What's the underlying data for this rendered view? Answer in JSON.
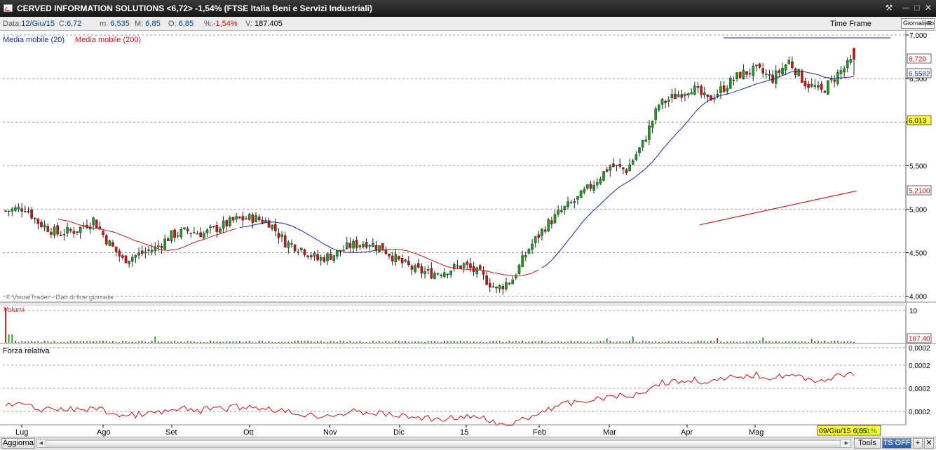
{
  "window": {
    "title": "CERVED INFORMATION SOLUTIONS <6,72> -1,54%  (FTSE Italia Beni e Servizi Industriali)",
    "buttons": [
      "wrench-icon",
      "minimize-icon",
      "maximize-icon",
      "close-icon"
    ]
  },
  "info": {
    "data_label": "Data:",
    "data_value": "12/Giu/15",
    "close_label": "C:",
    "close_value": "6,72",
    "min_label": "m:",
    "min_value": "6,535",
    "max_label": "M:",
    "max_value": "6,85",
    "open_label": "O:",
    "open_value": "6,85",
    "pct_label": "%:",
    "pct_value": "-1,54%",
    "vol_label": "V:",
    "vol_value": "187.405",
    "timeframe_label": "Time Frame",
    "timeframe_value": "Giornaliero"
  },
  "legend": {
    "ma20": "Media mobile (20)",
    "ma200": "Media mobile (200)"
  },
  "watermark": "© VisualTrader - Dati di fine giornata",
  "panels": {
    "volume_title": "Volumi",
    "volume_axis": "10",
    "rs_title": "Forza relativa"
  },
  "price_axis": {
    "ticks": [
      "7,000",
      "6,500",
      "6,000",
      "5,500",
      "5,000",
      "4,500",
      "4,000"
    ]
  },
  "badges": {
    "last": "6,720",
    "ma20": "6,5582",
    "level": "6,013",
    "ma200": "5,2100",
    "volume": "187.40"
  },
  "rs_axis": [
    "0,0002",
    "0,0002",
    "0,0002",
    "0,0002"
  ],
  "x_axis": [
    "Lug",
    "Ago",
    "Set",
    "Ott",
    "Nov",
    "Dic",
    "15",
    "Feb",
    "Mar",
    "Apr",
    "Mag"
  ],
  "cursor_info": {
    "date": "09/Giu/15",
    "value": "6,65",
    "pct": "0,61%"
  },
  "bottom": {
    "aggiorna": "Aggiorna",
    "tools": "Tools",
    "ts_off": "TS OFF",
    "plus": "+"
  },
  "colors": {
    "up": "#1f9a1f",
    "down": "#c81414",
    "ma20": "#1a2a9e",
    "ma200": "#cc1a1a",
    "rs": "#c81414",
    "level_badge": "#ffff33",
    "grid": "#9a9a9a"
  },
  "chart_data": {
    "type": "candlestick",
    "series_note": "daily OHLC approximations, Jul 2014 - Jun 2015",
    "ylim": [
      4.0,
      7.0
    ],
    "anchors": [
      [
        0,
        4.98
      ],
      [
        6,
        5.02
      ],
      [
        10,
        4.85
      ],
      [
        16,
        4.72
      ],
      [
        22,
        4.76
      ],
      [
        27,
        4.88
      ],
      [
        31,
        4.65
      ],
      [
        36,
        4.42
      ],
      [
        41,
        4.48
      ],
      [
        46,
        4.55
      ],
      [
        51,
        4.7
      ],
      [
        56,
        4.75
      ],
      [
        61,
        4.72
      ],
      [
        66,
        4.8
      ],
      [
        71,
        4.88
      ],
      [
        76,
        4.9
      ],
      [
        81,
        4.85
      ],
      [
        86,
        4.62
      ],
      [
        91,
        4.55
      ],
      [
        96,
        4.42
      ],
      [
        101,
        4.48
      ],
      [
        106,
        4.58
      ],
      [
        111,
        4.62
      ],
      [
        116,
        4.55
      ],
      [
        121,
        4.4
      ],
      [
        126,
        4.3
      ],
      [
        131,
        4.26
      ],
      [
        136,
        4.3
      ],
      [
        141,
        4.36
      ],
      [
        146,
        4.25
      ],
      [
        151,
        4.08
      ],
      [
        156,
        4.2
      ],
      [
        161,
        4.55
      ],
      [
        166,
        4.8
      ],
      [
        171,
        4.98
      ],
      [
        176,
        5.12
      ],
      [
        181,
        5.3
      ],
      [
        186,
        5.5
      ],
      [
        191,
        5.45
      ],
      [
        196,
        5.75
      ],
      [
        201,
        6.2
      ],
      [
        206,
        6.3
      ],
      [
        211,
        6.4
      ],
      [
        216,
        6.25
      ],
      [
        221,
        6.4
      ],
      [
        226,
        6.55
      ],
      [
        231,
        6.6
      ],
      [
        236,
        6.5
      ],
      [
        241,
        6.7
      ],
      [
        246,
        6.45
      ],
      [
        251,
        6.35
      ],
      [
        256,
        6.55
      ],
      [
        261,
        6.72
      ]
    ],
    "ma20_range": [
      0,
      261
    ],
    "ma200_range": [
      233,
      261
    ],
    "ma200_values": [
      4.82,
      5.21
    ]
  }
}
